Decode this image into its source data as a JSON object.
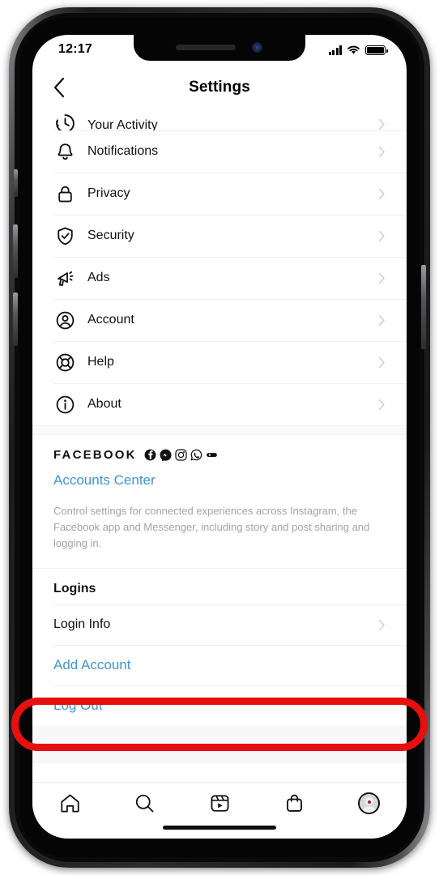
{
  "status_bar": {
    "time": "12:17",
    "signal_icon": "cellular-signal-icon",
    "wifi_icon": "wifi-icon",
    "battery_icon": "battery-full-icon"
  },
  "header": {
    "title": "Settings",
    "back_icon": "chevron-left-icon"
  },
  "settings_list": [
    {
      "label": "Your Activity",
      "icon": "activity-clock-icon",
      "chevron": true,
      "clipped": true
    },
    {
      "label": "Notifications",
      "icon": "bell-icon",
      "chevron": true
    },
    {
      "label": "Privacy",
      "icon": "lock-icon",
      "chevron": true
    },
    {
      "label": "Security",
      "icon": "shield-check-icon",
      "chevron": true
    },
    {
      "label": "Ads",
      "icon": "megaphone-icon",
      "chevron": true
    },
    {
      "label": "Account",
      "icon": "person-circle-icon",
      "chevron": true
    },
    {
      "label": "Help",
      "icon": "lifebuoy-icon",
      "chevron": true
    },
    {
      "label": "About",
      "icon": "info-circle-icon",
      "chevron": true
    }
  ],
  "facebook_section": {
    "wordmark": "FACEBOOK",
    "app_icons": [
      "facebook-icon",
      "messenger-icon",
      "instagram-icon",
      "whatsapp-icon",
      "portal-icon"
    ],
    "accounts_center_label": "Accounts Center",
    "description": "Control settings for connected experiences across Instagram, the Facebook app and Messenger, including story and post sharing and logging in."
  },
  "logins_section": {
    "heading": "Logins",
    "login_info_label": "Login Info",
    "add_account_label": "Add Account",
    "log_out_label": "Log Out"
  },
  "tab_bar": [
    {
      "name": "home",
      "icon": "home-icon"
    },
    {
      "name": "search",
      "icon": "search-icon"
    },
    {
      "name": "reels",
      "icon": "reels-icon"
    },
    {
      "name": "shop",
      "icon": "shopping-bag-icon"
    },
    {
      "name": "profile",
      "icon": "avatar-icon"
    }
  ],
  "annotation": {
    "shape": "red-oval-highlight",
    "target": "Log Out",
    "color": "#e80f0f"
  },
  "colors": {
    "link_blue": "#3f95cf",
    "text_primary": "#111111",
    "text_muted": "#a3a3a3",
    "separator": "#efefef",
    "annotation_red": "#e80f0f"
  }
}
